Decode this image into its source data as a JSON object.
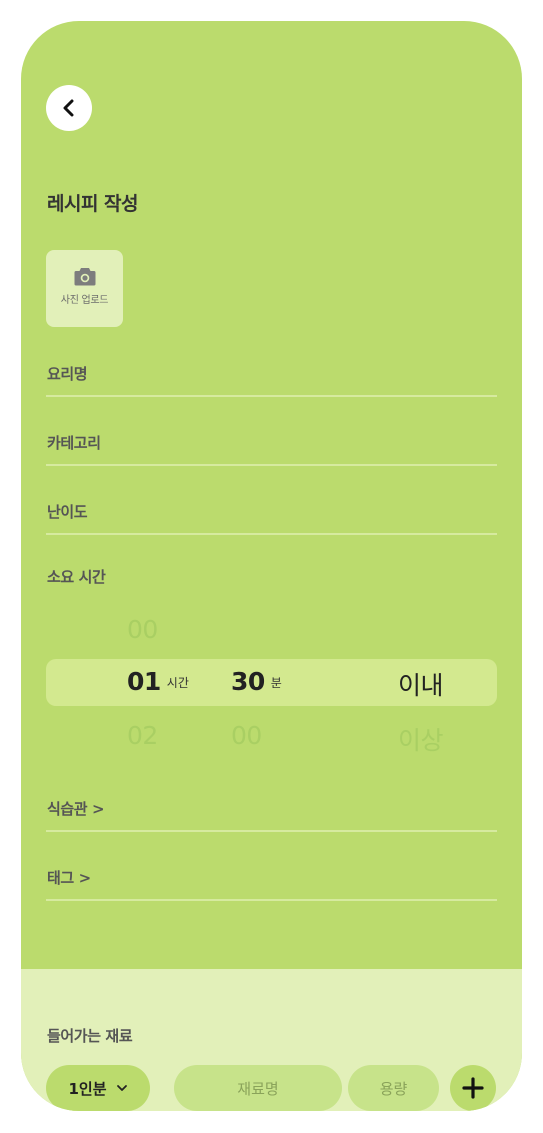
{
  "header": {
    "back_icon": "chevron-left-icon",
    "title": "레시피 작성"
  },
  "upload": {
    "icon": "camera-icon",
    "label": "사진 업로드"
  },
  "fields": {
    "dish_name": "요리명",
    "category": "카테고리",
    "difficulty": "난이도"
  },
  "time": {
    "section_label": "소요 시간",
    "hours_prev": "00",
    "hours_selected": "01",
    "hours_next": "02",
    "hours_unit": "시간",
    "minutes_selected": "30",
    "minutes_next": "00",
    "minutes_unit": "분",
    "qualifier_selected": "이내",
    "qualifier_next": "이상"
  },
  "links": {
    "habits": "식습관 >",
    "tags": "태그 >"
  },
  "ingredients": {
    "label": "들어가는 재료",
    "serving": "1인분",
    "serving_icon": "chevron-down-icon",
    "name_placeholder": "재료명",
    "amount_placeholder": "용량",
    "add_icon": "plus-icon"
  },
  "colors": {
    "background": "#bbdb6d",
    "panel": "#e2f0b9",
    "highlight": "#d3e98f",
    "divider": "#d6ea9f"
  }
}
